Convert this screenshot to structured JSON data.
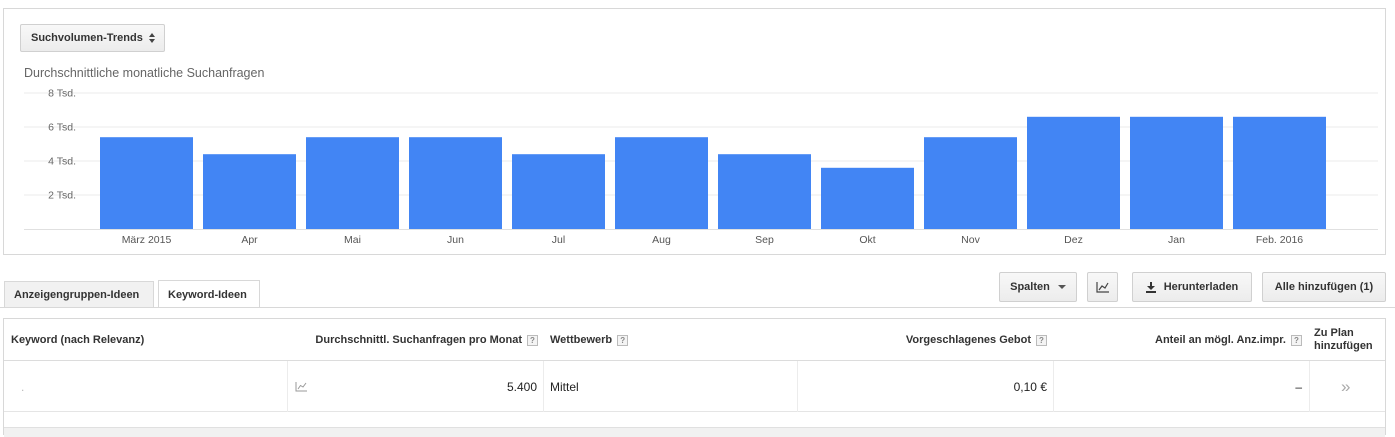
{
  "chart_card": {
    "selector_label": "Suchvolumen-Trends",
    "title": "Durchschnittliche monatliche Suchanfragen"
  },
  "chart_data": {
    "type": "bar",
    "title": "Durchschnittliche monatliche Suchanfragen",
    "categories": [
      "März 2015",
      "Apr",
      "Mai",
      "Jun",
      "Jul",
      "Aug",
      "Sep",
      "Okt",
      "Nov",
      "Dez",
      "Jan",
      "Feb. 2016"
    ],
    "values": [
      5400,
      4400,
      5400,
      5400,
      4400,
      5400,
      4400,
      3600,
      5400,
      6600,
      6600,
      6600
    ],
    "yticks": [
      2000,
      4000,
      6000,
      8000
    ],
    "ytick_labels": [
      "2 Tsd.",
      "4 Tsd.",
      "6 Tsd.",
      "8 Tsd."
    ],
    "ylim": [
      0,
      8000
    ],
    "grid": true,
    "bar_color": "#4285f4"
  },
  "tabs": {
    "adgroup_ideas": "Anzeigengruppen-Ideen",
    "keyword_ideas": "Keyword-Ideen"
  },
  "toolbar": {
    "columns_label": "Spalten",
    "download_label": "Herunterladen",
    "add_all_label": "Alle hinzufügen (1)"
  },
  "table": {
    "headers": {
      "keyword": "Keyword (nach Relevanz)",
      "avg_searches": "Durchschnittl. Suchanfragen pro Monat",
      "competition": "Wettbewerb",
      "suggested_bid": "Vorgeschlagenes Gebot",
      "impr_share": "Anteil an mögl. Anz.impr.",
      "add_to_plan_line1": "Zu Plan",
      "add_to_plan_line2": "hinzufügen"
    },
    "help_glyph": "?",
    "rows": [
      {
        "keyword": ".",
        "avg_searches": "5.400",
        "competition": "Mittel",
        "suggested_bid": "0,10 €",
        "impr_share": "–",
        "add_glyph": "»"
      }
    ]
  }
}
